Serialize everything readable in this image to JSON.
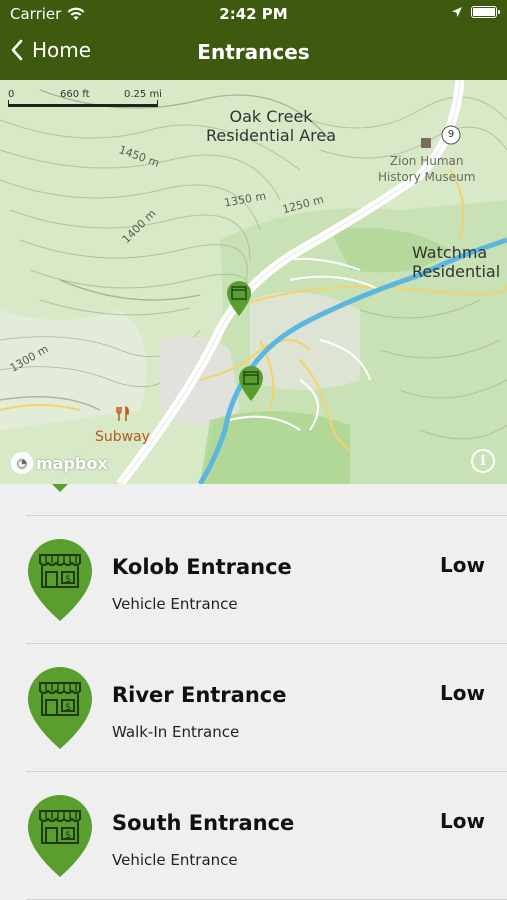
{
  "status_bar": {
    "carrier": "Carrier",
    "time": "2:42 PM"
  },
  "nav": {
    "back_label": "Home",
    "title": "Entrances"
  },
  "map": {
    "scale": {
      "left": "0",
      "mid": "660 ft",
      "right": "0.25 mi"
    },
    "labels": {
      "oak_creek_line1": "Oak Creek",
      "oak_creek_line2": "Residential Area",
      "museum_line1": "Zion Human",
      "museum_line2": "History Museum",
      "watchman_line1": "Watchma",
      "watchman_line2": "Residential",
      "subway": "Subway",
      "road_shield": "9",
      "contour_1450": "1450 m",
      "contour_1350": "1350 m",
      "contour_1250": "1250 m",
      "contour_1400": "1400 m",
      "contour_1300": "1300 m"
    },
    "attribution": "mapbox",
    "info_symbol": "i",
    "colors": {
      "land": "#d7e8c7",
      "river": "#5bb6e0",
      "road": "#ffffff",
      "minor_road": "#f3d36a",
      "pin": "#5a9e2f"
    }
  },
  "entrances": [
    {
      "name": "Kolob Entrance",
      "type": "Vehicle Entrance",
      "level": "Low",
      "icon": "entrance-store-icon"
    },
    {
      "name": "River Entrance",
      "type": "Walk-In Entrance",
      "level": "Low",
      "icon": "entrance-store-icon"
    },
    {
      "name": "South Entrance",
      "type": "Vehicle Entrance",
      "level": "Low",
      "icon": "entrance-store-icon"
    }
  ]
}
